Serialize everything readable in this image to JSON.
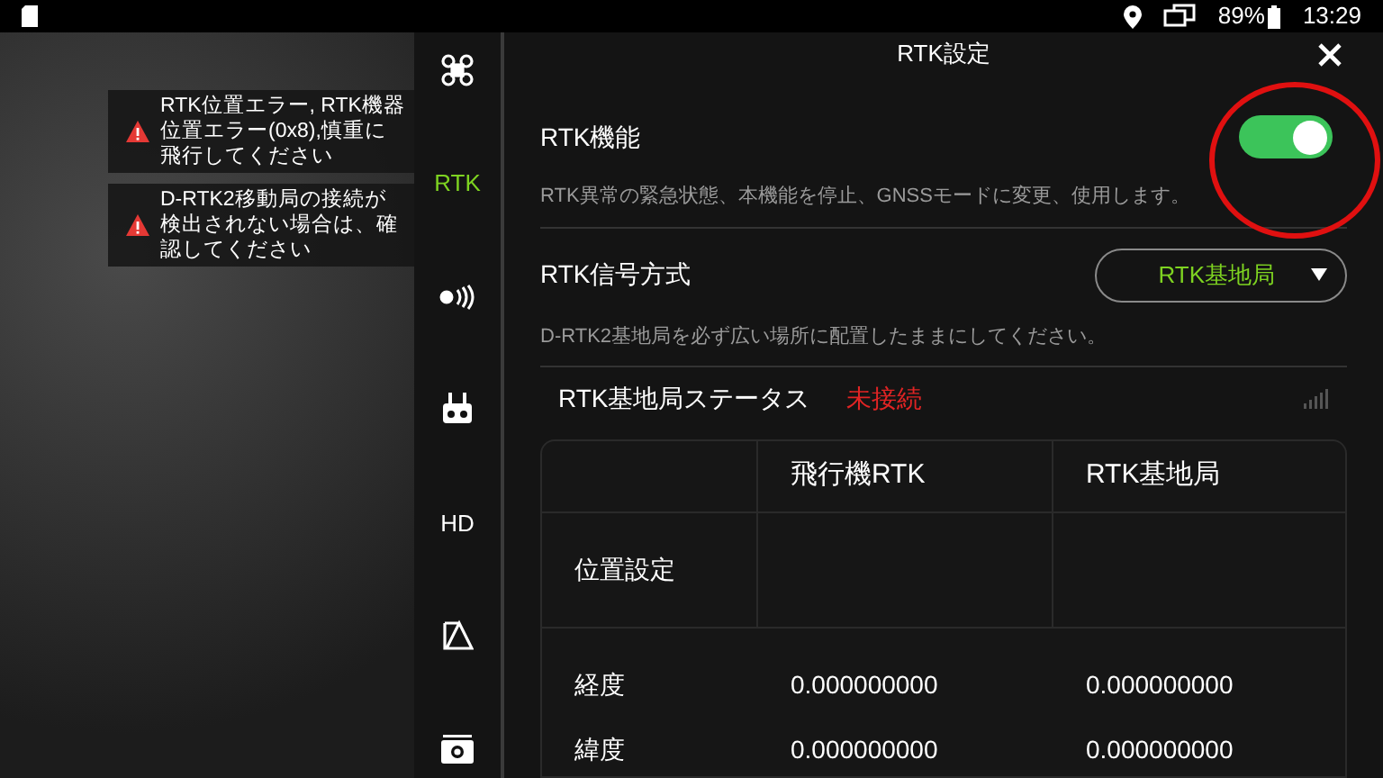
{
  "status_bar": {
    "battery": "89%",
    "time": "13:29"
  },
  "alerts": [
    {
      "text": "RTK位置エラー, RTK機器位置エラー(0x8),慎重に飛行してください"
    },
    {
      "text": "D-RTK2移動局の接続が検出されない場合は、確認してください"
    }
  ],
  "sidebar": {
    "items": [
      {
        "kind": "drone",
        "selected": false
      },
      {
        "kind": "label",
        "label": "RTK",
        "selected": true
      },
      {
        "kind": "signal",
        "selected": false
      },
      {
        "kind": "remote",
        "selected": false
      },
      {
        "kind": "label",
        "label": "HD",
        "selected": false
      },
      {
        "kind": "map",
        "selected": false
      },
      {
        "kind": "camera",
        "selected": false
      }
    ]
  },
  "panel": {
    "title": "RTK設定",
    "rtk_function": {
      "label": "RTK機能",
      "on": true,
      "description": "RTK異常の緊急状態、本機能を停止、GNSSモードに変更、使用します。"
    },
    "signal_method": {
      "label": "RTK信号方式",
      "value": "RTK基地局",
      "note": "D-RTK2基地局を必ず広い場所に配置したままにしてください。"
    },
    "status": {
      "label": "RTK基地局ステータス",
      "value": "未接続"
    },
    "table": {
      "columns": [
        "飛行機RTK",
        "RTK基地局"
      ],
      "rows": [
        {
          "label": "位置設定"
        },
        {
          "label": "経度",
          "values": [
            "0.000000000",
            "0.000000000"
          ]
        },
        {
          "label": "緯度",
          "values": [
            "0.000000000",
            "0.000000000"
          ]
        }
      ]
    }
  }
}
